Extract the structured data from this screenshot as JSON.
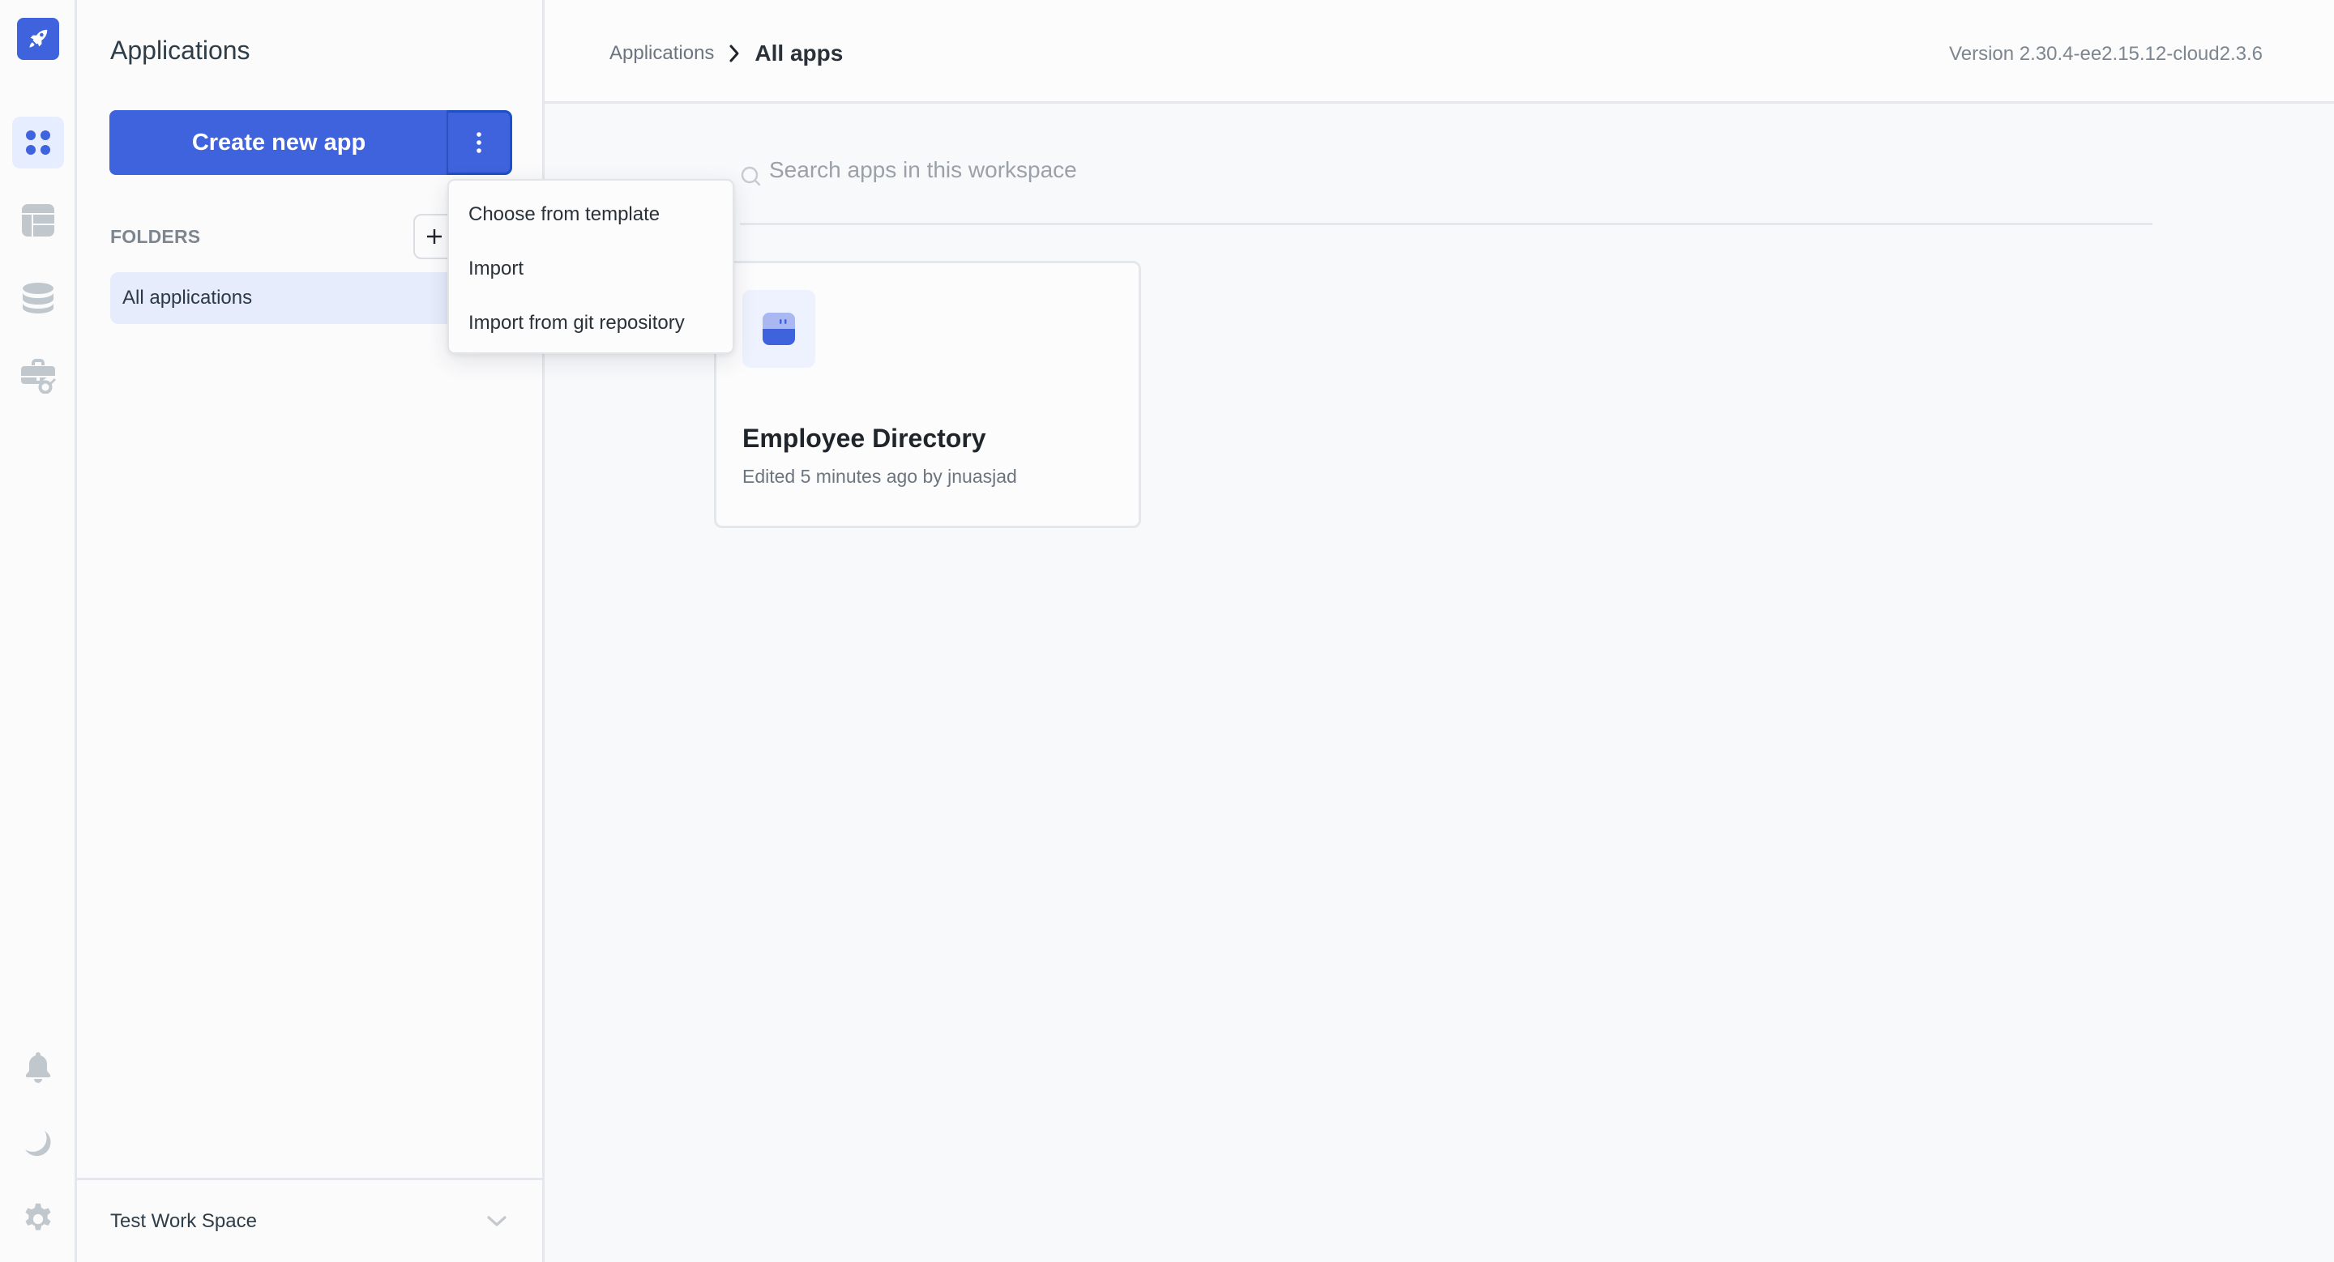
{
  "rail": {
    "logo_icon": "rocket-icon",
    "items": [
      {
        "name": "apps",
        "icon": "grid-icon",
        "active": true
      },
      {
        "name": "tables",
        "icon": "table-icon",
        "active": false
      },
      {
        "name": "database",
        "icon": "database-icon",
        "active": false
      },
      {
        "name": "workspace-constants",
        "icon": "briefcase-key-icon",
        "active": false
      }
    ],
    "bottom_items": [
      {
        "name": "notifications",
        "icon": "bell-icon"
      },
      {
        "name": "theme",
        "icon": "moon-icon"
      },
      {
        "name": "settings",
        "icon": "gear-icon"
      }
    ],
    "accent": "#3e63dd",
    "inactive_icon_color": "#c1c8cd"
  },
  "sidebar": {
    "title": "Applications",
    "create_button_label": "Create new app",
    "more_icon": "kebab-icon",
    "folders_label": "FOLDERS",
    "add_folder_icon": "plus-icon",
    "folders": [
      {
        "label": "All applications",
        "active": true
      }
    ],
    "workspace": {
      "name": "Test Work Space",
      "chevron_icon": "chevron-down-icon"
    }
  },
  "header": {
    "breadcrumb": {
      "parent": "Applications",
      "separator_icon": "chevron-right-icon",
      "current": "All apps"
    },
    "version": "Version 2.30.4-ee2.15.12-cloud2.3.6"
  },
  "main": {
    "search": {
      "placeholder": "Search apps in this workspace",
      "value": "",
      "icon": "search-icon"
    },
    "apps": [
      {
        "name": "Employee Directory",
        "meta": "Edited 5 minutes ago by jnuasjad",
        "icon": "app-icon"
      }
    ]
  },
  "dropdown": {
    "items": [
      {
        "label": "Choose from template"
      },
      {
        "label": "Import"
      },
      {
        "label": "Import from git repository"
      }
    ]
  }
}
